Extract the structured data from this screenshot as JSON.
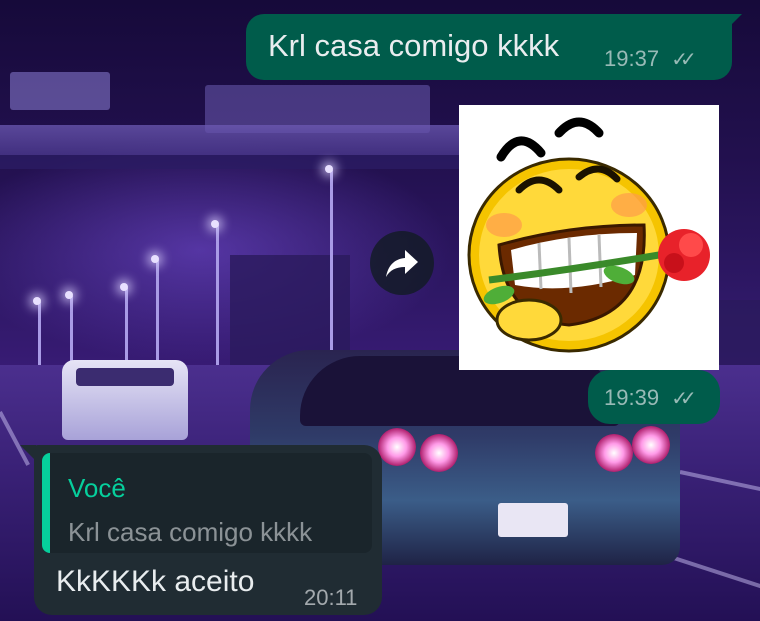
{
  "chat": {
    "messages": [
      {
        "direction": "outgoing",
        "text": "Krl casa comigo kkkk",
        "time": "19:37",
        "status": "read"
      },
      {
        "direction": "outgoing",
        "type": "sticker",
        "sticker": "laughing-emoji-with-rose",
        "time": "19:39",
        "status": "read"
      },
      {
        "direction": "incoming",
        "reply_to": {
          "author": "Você",
          "text": "Krl casa comigo kkkk"
        },
        "text": "KkKKKk aceito",
        "time": "20:11"
      }
    ],
    "forward_icon": "forward-icon",
    "read_ticks_icon": "double-check-icon"
  },
  "colors": {
    "outgoing_bubble": "#005c4b",
    "incoming_bubble": "#202c33",
    "quote_accent": "#06cf9c",
    "text": "#e9edef"
  }
}
